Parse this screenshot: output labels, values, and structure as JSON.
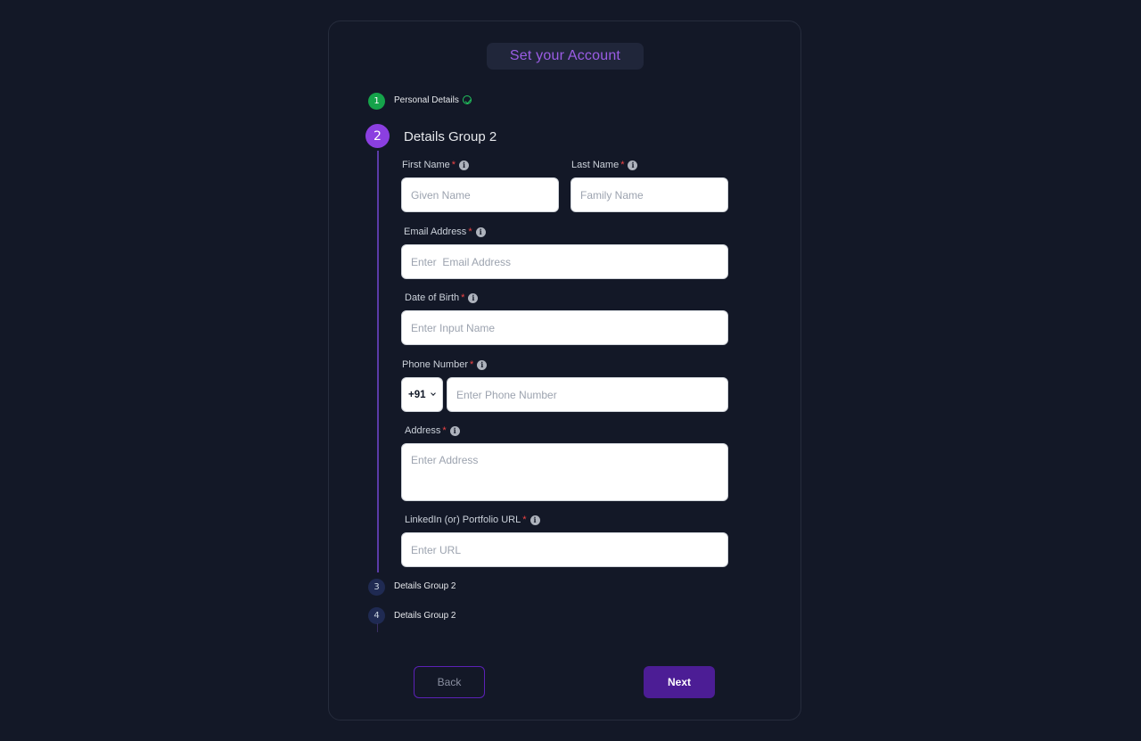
{
  "page": {
    "title": "Set your Account"
  },
  "steps": [
    {
      "number": "1",
      "label": "Personal Details",
      "status": "done"
    },
    {
      "number": "2",
      "label": "Details Group 2",
      "status": "active"
    },
    {
      "number": "3",
      "label": "Details Group 2",
      "status": "pending"
    },
    {
      "number": "4",
      "label": "Details Group 2",
      "status": "pending"
    }
  ],
  "form": {
    "required_mark": "*",
    "info_glyph": "i",
    "first_name": {
      "label": "First Name",
      "placeholder": "Given Name"
    },
    "last_name": {
      "label": "Last Name",
      "placeholder": "Family Name"
    },
    "email": {
      "label": "Email Address",
      "placeholder": "Enter  Email Address"
    },
    "dob": {
      "label": "Date of Birth",
      "placeholder": "Enter Input Name"
    },
    "phone": {
      "label": "Phone Number",
      "country_code": "+91",
      "placeholder": "Enter Phone Number"
    },
    "address": {
      "label": "Address",
      "placeholder": "Enter Address"
    },
    "url": {
      "label": "LinkedIn (or) Portfolio URL",
      "placeholder": "Enter URL"
    }
  },
  "actions": {
    "back_label": "Back",
    "next_label": "Next"
  },
  "colors": {
    "background": "#131827",
    "accent": "#8b3fe0",
    "done": "#15a34a",
    "required": "#ef4444",
    "next_button": "#4c1d95"
  }
}
